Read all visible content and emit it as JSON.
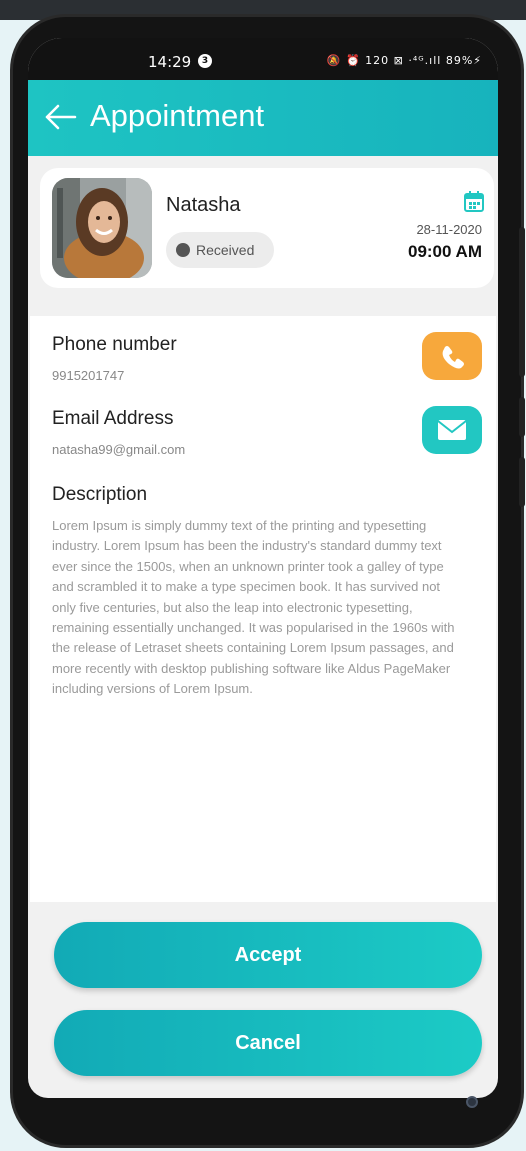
{
  "status_bar": {
    "time": "14:29",
    "notification_count": "3",
    "right_indicators": "🔕 ⏰ 120 ⊠ ·⁴ᴳ.ıll 89%⚡"
  },
  "header": {
    "title": "Appointment",
    "back_icon": "arrow-left-icon"
  },
  "profile": {
    "name": "Natasha",
    "status": "Received",
    "date": "28-11-2020",
    "time": "09:00 AM"
  },
  "contact": {
    "phone_label": "Phone number",
    "phone_value": "9915201747",
    "email_label": "Email Address",
    "email_value": "natasha99@gmail.com"
  },
  "description": {
    "label": "Description",
    "text": "Lorem Ipsum is simply dummy text of the printing and typesetting industry. Lorem Ipsum has been the industry's standard dummy text ever since the 1500s, when an unknown printer took a galley of type and scrambled it to make a type specimen book. It has survived not only five centuries, but also the leap into electronic typesetting, remaining essentially unchanged. It was popularised in the 1960s with the release of Letraset sheets containing Lorem Ipsum passages, and more recently with desktop publishing software like Aldus PageMaker including versions of Lorem Ipsum."
  },
  "actions": {
    "accept_label": "Accept",
    "cancel_label": "Cancel"
  },
  "colors": {
    "accent": "#1ec4c3",
    "call": "#f7a83c",
    "email": "#22c7c2"
  }
}
